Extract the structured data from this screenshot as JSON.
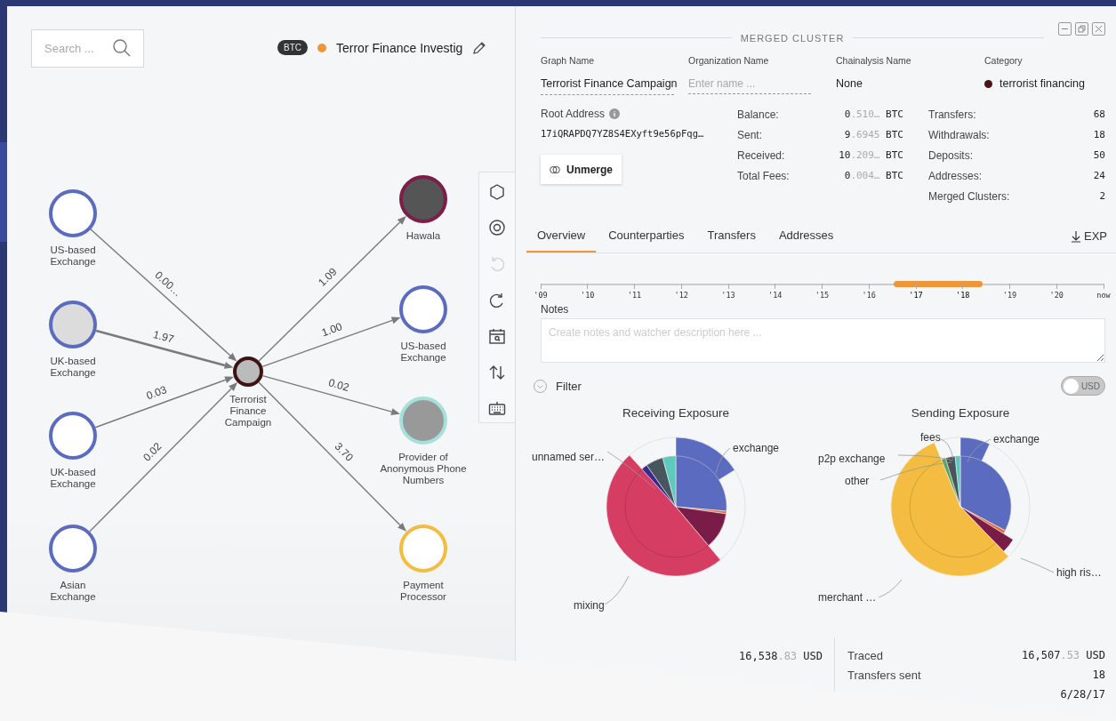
{
  "graph_panel": {
    "search": {
      "placeholder": "Search ..."
    },
    "currency_badge": "BTC",
    "graph_title": "Terror Finance Investig",
    "nodes": [
      {
        "label": "US-based Exchange",
        "color": "#5b6bbf",
        "kind": "empty"
      },
      {
        "label": "UK-based Exchange",
        "color": "#5b6bbf",
        "kind": "light"
      },
      {
        "label": "UK-based Exchange",
        "color": "#5b6bbf",
        "kind": "empty"
      },
      {
        "label": "Asian Exchange",
        "color": "#5b6bbf",
        "kind": "empty"
      },
      {
        "label": "Terrorist Finance Campaign",
        "color": "#3d1414",
        "kind": "center"
      },
      {
        "label": "Hawala",
        "color": "#7d1d4a",
        "kind": "dark"
      },
      {
        "label": "US-based Exchange",
        "color": "#5b6bbf",
        "kind": "empty"
      },
      {
        "label": "Provider of Anonymous Phone Numbers",
        "color": "#a6e0dc",
        "kind": "mid"
      },
      {
        "label": "Payment Processor",
        "color": "#f2bc41",
        "kind": "empty"
      }
    ],
    "edges": [
      {
        "label": "0.00…",
        "kind": "thin"
      },
      {
        "label": "1.97",
        "kind": "thick"
      },
      {
        "label": "0.03",
        "kind": "thin"
      },
      {
        "label": "0.02",
        "kind": "thin"
      },
      {
        "label": "1.09",
        "kind": "thin"
      },
      {
        "label": "1.00",
        "kind": "thin"
      },
      {
        "label": "0.02",
        "kind": "thin"
      },
      {
        "label": "3.70",
        "kind": "thin"
      }
    ],
    "toolbar": [
      {
        "kind": "hexagon",
        "disabled": false
      },
      {
        "kind": "target",
        "disabled": false
      },
      {
        "kind": "undo",
        "disabled": true
      },
      {
        "kind": "redo",
        "disabled": false
      },
      {
        "kind": "calendar",
        "disabled": false
      },
      {
        "kind": "sort",
        "disabled": false
      },
      {
        "kind": "keyboard",
        "disabled": false
      }
    ]
  },
  "cluster_panel": {
    "title": "MERGED CLUSTER",
    "fields": [
      {
        "label": "Graph Name",
        "value": "Terrorist Finance Campaign",
        "kind": "editable"
      },
      {
        "label": "Organization Name",
        "placeholder": "Enter name ...",
        "kind": "input"
      },
      {
        "label": "Chainalysis Name",
        "value": "None",
        "kind": "plain"
      },
      {
        "label": "Category",
        "value": "terrorist financing",
        "kind": "category",
        "color": "#4a1515"
      }
    ],
    "root_address": {
      "label": "Root Address",
      "value": "17iQRAPDQ7YZ8S4EXyft9e56pFqg…"
    },
    "unmerge_button": "Unmerge",
    "balances": [
      {
        "label": "Balance:",
        "value": "0.510… BTC"
      },
      {
        "label": "Sent:",
        "value": "9.6945 BTC"
      },
      {
        "label": "Received:",
        "value": "10.209… BTC"
      },
      {
        "label": "Total Fees:",
        "value": "0.004… BTC"
      }
    ],
    "counts": [
      {
        "label": "Transfers:",
        "value": "68"
      },
      {
        "label": "Withdrawals:",
        "value": "18"
      },
      {
        "label": "Deposits:",
        "value": "50"
      },
      {
        "label": "Addresses:",
        "value": "24"
      },
      {
        "label": "Merged Clusters:",
        "value": "2"
      }
    ],
    "tabs": [
      {
        "label": "Overview",
        "selected": true
      },
      {
        "label": "Counterparties",
        "selected": false
      },
      {
        "label": "Transfers",
        "selected": false
      },
      {
        "label": "Addresses",
        "selected": false
      }
    ],
    "export_link": "EXP",
    "timeline": [
      {
        "label": "'09",
        "in_range": false
      },
      {
        "label": "'10",
        "in_range": false
      },
      {
        "label": "'11",
        "in_range": false
      },
      {
        "label": "'12",
        "in_range": false
      },
      {
        "label": "'13",
        "in_range": false
      },
      {
        "label": "'14",
        "in_range": false
      },
      {
        "label": "'15",
        "in_range": false
      },
      {
        "label": "'16",
        "in_range": false
      },
      {
        "label": "'17",
        "in_range": true
      },
      {
        "label": "'18",
        "in_range": true
      },
      {
        "label": "'19",
        "in_range": false
      },
      {
        "label": "'20",
        "in_range": false
      },
      {
        "label": "now",
        "in_range": false
      }
    ],
    "notes": {
      "label": "Notes",
      "placeholder": "Create notes and watcher description here ..."
    },
    "filter": "Filter",
    "usd_toggle": {
      "label": "USD",
      "on": false
    },
    "receiving_exposure": {
      "title": "Receiving Exposure",
      "labels": [
        "exchange",
        "unnamed ser…",
        "mixing"
      ]
    },
    "sending_exposure": {
      "title": "Sending Exposure",
      "labels": [
        "exchange",
        "fees",
        "p2p exchange",
        "other",
        "merchant …",
        "high ris…"
      ]
    },
    "received_total": "16,538.83 USD",
    "sent_summary": [
      {
        "label": "Traced",
        "value": "16,507.53 USD"
      },
      {
        "label": "Transfers sent",
        "value": "18"
      },
      {
        "value": "6/28/17"
      }
    ]
  }
}
